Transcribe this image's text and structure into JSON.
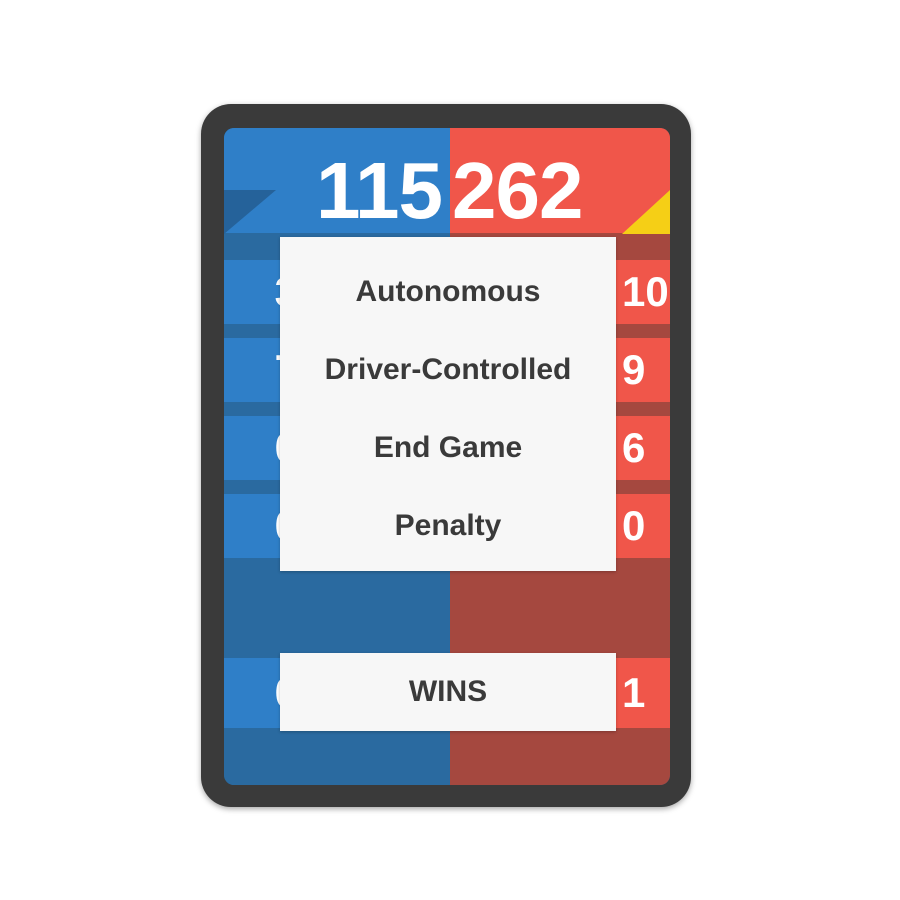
{
  "scores": {
    "blue": "115",
    "red": "262"
  },
  "menu": {
    "items": [
      {
        "label": "Autonomous"
      },
      {
        "label": "Driver-Controlled"
      },
      {
        "label": "End Game"
      },
      {
        "label": "Penalty"
      }
    ]
  },
  "wins_button": {
    "label": "WINS"
  },
  "side_values": {
    "blue": [
      "3",
      "7",
      "0",
      "0"
    ],
    "red": [
      "10",
      "9",
      "6",
      "0"
    ],
    "blue_wins": "0",
    "red_wins": "1"
  },
  "colors": {
    "blue_alliance": "#2f7fc8",
    "red_alliance": "#f0564a",
    "accent_yellow": "#f5cf16"
  }
}
